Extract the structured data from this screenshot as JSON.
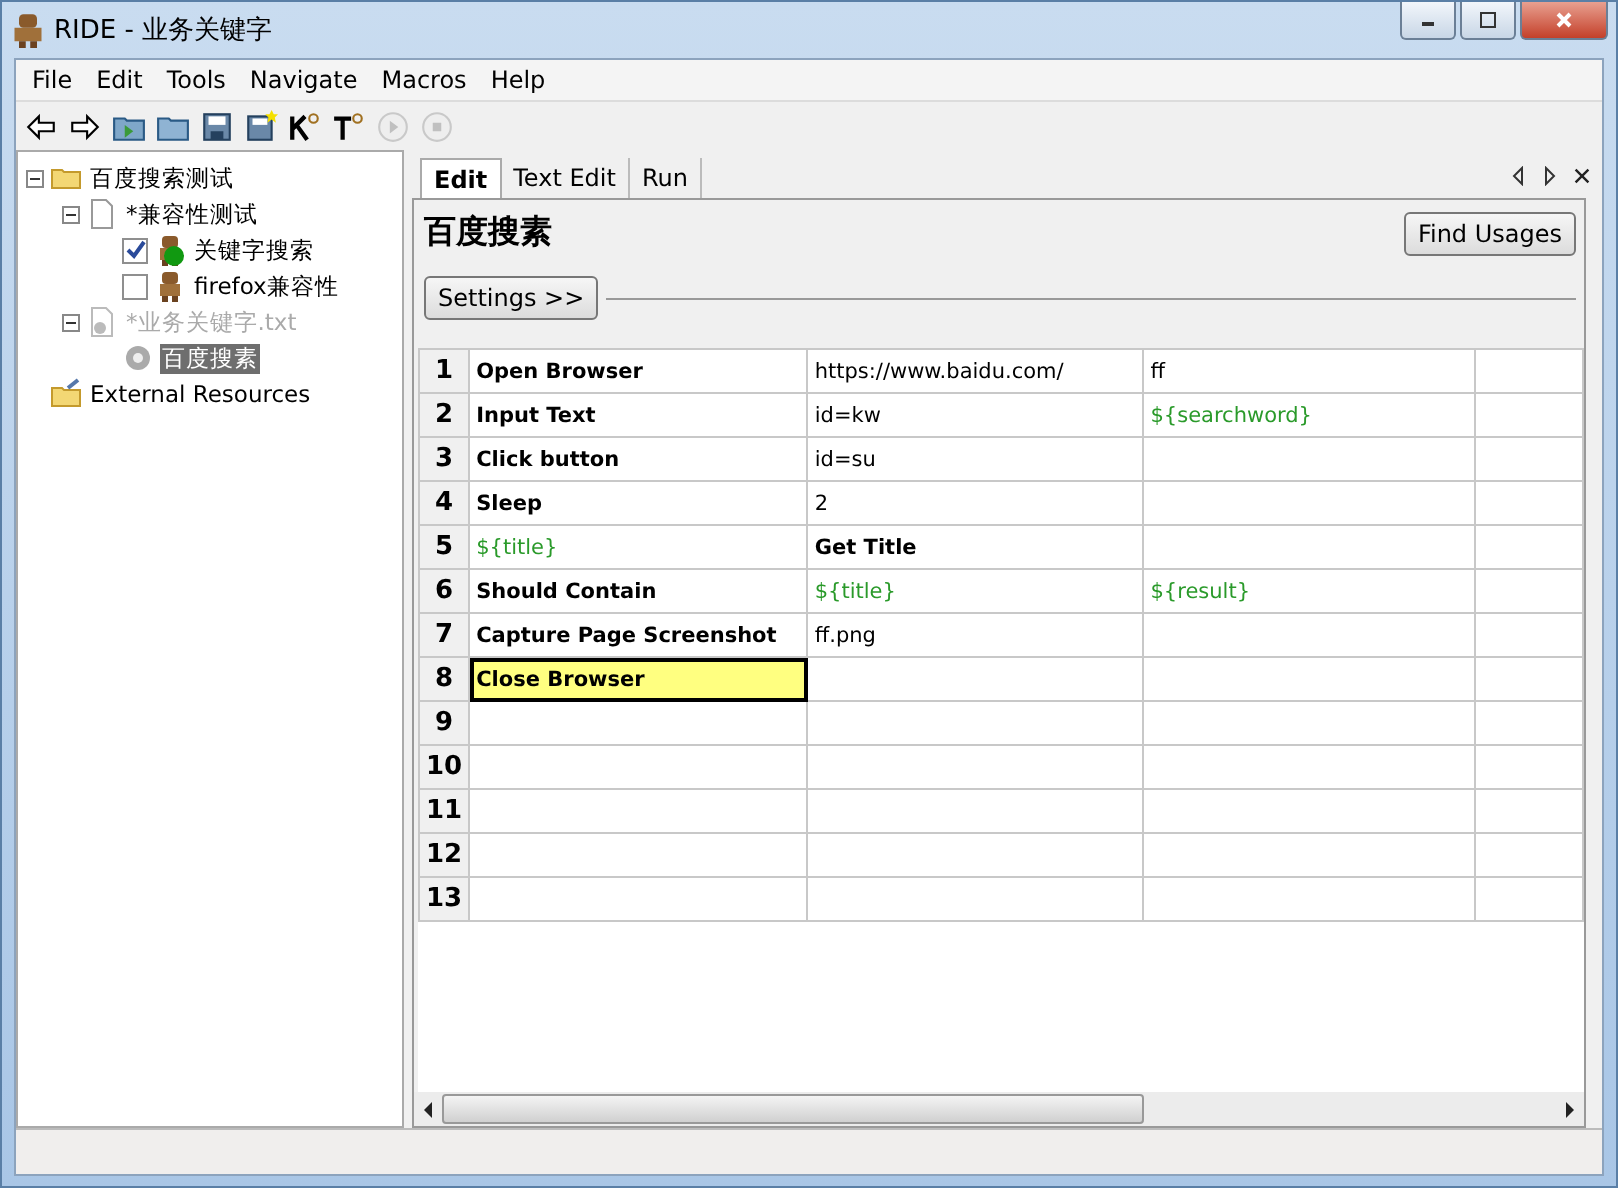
{
  "window": {
    "title": "RIDE - 业务关键字"
  },
  "menu": [
    "File",
    "Edit",
    "Tools",
    "Navigate",
    "Macros",
    "Help"
  ],
  "toolbar": [
    {
      "kind": "back",
      "disabled": false
    },
    {
      "kind": "forward",
      "disabled": false
    },
    {
      "kind": "open-folder-arrow",
      "disabled": false
    },
    {
      "kind": "folder",
      "disabled": false
    },
    {
      "kind": "save",
      "disabled": false
    },
    {
      "kind": "save-all",
      "disabled": false
    },
    {
      "kind": "search-k",
      "disabled": false
    },
    {
      "kind": "search-t",
      "disabled": false
    },
    {
      "kind": "play",
      "disabled": true
    },
    {
      "kind": "stop",
      "disabled": true
    }
  ],
  "tree": [
    {
      "label": "百度搜索测试",
      "kind": "folder",
      "expanded": true,
      "selected": false,
      "dimmed": false,
      "children": [
        {
          "label": "*兼容性测试",
          "kind": "file",
          "expanded": true,
          "selected": false,
          "dimmed": false,
          "children": [
            {
              "label": "关键字搜索",
              "kind": "test",
              "checked": true,
              "passed": true,
              "selected": false,
              "dimmed": false
            },
            {
              "label": "firefox兼容性",
              "kind": "test",
              "checked": false,
              "passed": false,
              "selected": false,
              "dimmed": false
            }
          ]
        },
        {
          "label": "*业务关键字.txt",
          "kind": "resource",
          "expanded": true,
          "selected": false,
          "dimmed": true,
          "children": [
            {
              "label": "百度搜素",
              "kind": "keyword",
              "selected": true,
              "dimmed": false
            }
          ]
        }
      ]
    },
    {
      "label": "External Resources",
      "kind": "external",
      "selected": false,
      "dimmed": false
    }
  ],
  "tabs": [
    {
      "label": "Edit",
      "selected": true
    },
    {
      "label": "Text Edit",
      "selected": false
    },
    {
      "label": "Run",
      "selected": false
    }
  ],
  "editor": {
    "title": "百度搜素",
    "find_usages": "Find Usages",
    "settings": "Settings >>",
    "rows": [
      {
        "number": "1",
        "cells": [
          {
            "text": "Open Browser",
            "kind": "keyword",
            "selected": false
          },
          {
            "text": "https://www.baidu.com/",
            "kind": "arg",
            "selected": false
          },
          {
            "text": "ff",
            "kind": "arg",
            "selected": false
          }
        ]
      },
      {
        "number": "2",
        "cells": [
          {
            "text": "Input Text",
            "kind": "keyword",
            "selected": false
          },
          {
            "text": "id=kw",
            "kind": "arg",
            "selected": false
          },
          {
            "text": "${searchword}",
            "kind": "variable",
            "selected": false
          }
        ]
      },
      {
        "number": "3",
        "cells": [
          {
            "text": "Click button",
            "kind": "keyword",
            "selected": false
          },
          {
            "text": "id=su",
            "kind": "arg",
            "selected": false
          }
        ]
      },
      {
        "number": "4",
        "cells": [
          {
            "text": "Sleep",
            "kind": "keyword",
            "selected": false
          },
          {
            "text": "2",
            "kind": "arg",
            "selected": false
          }
        ]
      },
      {
        "number": "5",
        "cells": [
          {
            "text": "${title}",
            "kind": "variable",
            "selected": false
          },
          {
            "text": "Get Title",
            "kind": "keyword",
            "selected": false
          }
        ]
      },
      {
        "number": "6",
        "cells": [
          {
            "text": "Should Contain",
            "kind": "keyword",
            "selected": false
          },
          {
            "text": "${title}",
            "kind": "variable",
            "selected": false
          },
          {
            "text": "${result}",
            "kind": "variable",
            "selected": false
          }
        ]
      },
      {
        "number": "7",
        "cells": [
          {
            "text": "Capture Page Screenshot",
            "kind": "keyword",
            "selected": false
          },
          {
            "text": "ff.png",
            "kind": "arg",
            "selected": false
          }
        ]
      },
      {
        "number": "8",
        "cells": [
          {
            "text": "Close Browser",
            "kind": "keyword",
            "selected": true
          }
        ]
      },
      {
        "number": "9"
      },
      {
        "number": "10"
      },
      {
        "number": "11"
      },
      {
        "number": "12"
      },
      {
        "number": "13"
      }
    ]
  }
}
